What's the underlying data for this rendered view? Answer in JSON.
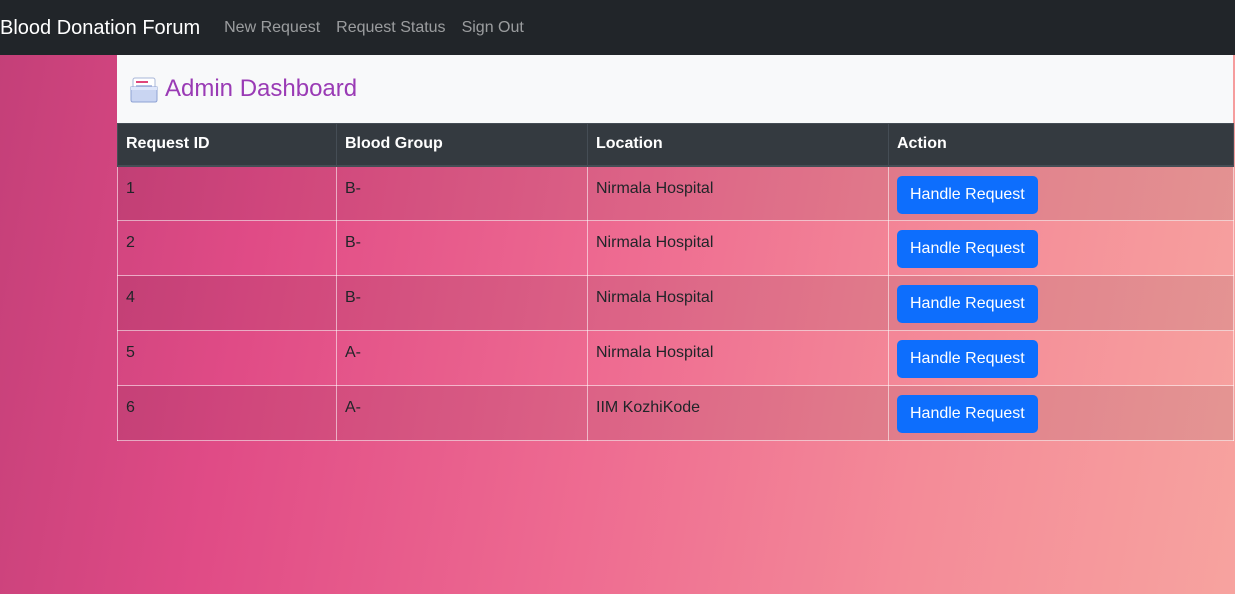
{
  "navbar": {
    "brand": "Blood Donation Forum",
    "links": [
      {
        "label": "New Request"
      },
      {
        "label": "Request Status"
      },
      {
        "label": "Sign Out"
      }
    ]
  },
  "dashboard": {
    "title": "Admin Dashboard",
    "icon": "document-stack-icon"
  },
  "table": {
    "columns": [
      "Request ID",
      "Blood Group",
      "Location",
      "Action"
    ],
    "rows": [
      {
        "id": "1",
        "blood_group": "B-",
        "location": "Nirmala Hospital",
        "action": "Handle Request"
      },
      {
        "id": "2",
        "blood_group": "B-",
        "location": "Nirmala Hospital",
        "action": "Handle Request"
      },
      {
        "id": "4",
        "blood_group": "B-",
        "location": "Nirmala Hospital",
        "action": "Handle Request"
      },
      {
        "id": "5",
        "blood_group": "A-",
        "location": "Nirmala Hospital",
        "action": "Handle Request"
      },
      {
        "id": "6",
        "blood_group": "A-",
        "location": "IIM KozhiKode",
        "action": "Handle Request"
      }
    ]
  },
  "colors": {
    "navbar_bg": "#212529",
    "title_color": "#9a3bb5",
    "button_bg": "#0d6efd",
    "table_header_bg": "#343a40"
  }
}
